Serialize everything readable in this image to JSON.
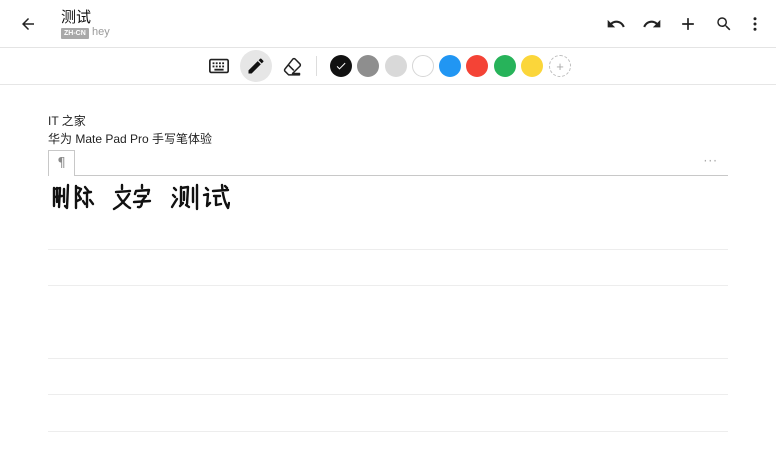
{
  "header": {
    "title": "测试",
    "language_badge": "ZH-CN",
    "subtitle": "hey",
    "actions": [
      "undo-icon",
      "redo-icon",
      "plus-icon",
      "search-icon",
      "more-vert-icon"
    ]
  },
  "toolbar": {
    "tools": [
      {
        "name": "keyboard-icon",
        "active": false
      },
      {
        "name": "pen-icon",
        "active": true
      },
      {
        "name": "eraser-icon",
        "active": false
      }
    ],
    "colors": [
      "#111111",
      "#8e8e8e",
      "#d9d9d9",
      "#ffffff",
      "#2196f3",
      "#f44336",
      "#27b35a",
      "#fbd63a"
    ],
    "selected_color": "#111111",
    "add_color_label": "+"
  },
  "note": {
    "lines": [
      "IT 之家",
      "华为 Mate Pad Pro 手写笔体验"
    ],
    "paragraph_mark": "¶",
    "paragraph_more": "···",
    "handwritten_text": "删除文字测试"
  }
}
